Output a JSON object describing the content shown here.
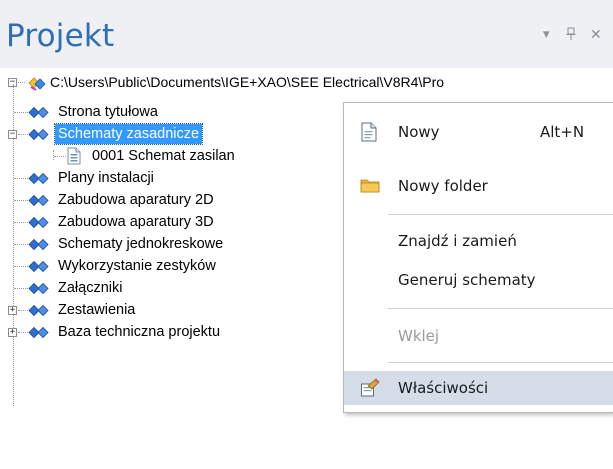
{
  "panel": {
    "title": "Projekt",
    "dropdown_glyph": "▾",
    "pin_glyph": "ᚂ",
    "close_glyph": "✕"
  },
  "tree": {
    "root_path": "C:\\Users\\Public\\Documents\\IGE+XAO\\SEE Electrical\\V8R4\\Pro",
    "items": [
      {
        "label": "Strona tytułowa"
      },
      {
        "label": "Schematy zasadnicze"
      },
      {
        "label": "0001 Schemat zasilan"
      },
      {
        "label": "Plany instalacji"
      },
      {
        "label": "Zabudowa aparatury 2D"
      },
      {
        "label": "Zabudowa aparatury 3D"
      },
      {
        "label": "Schematy jednokreskowe"
      },
      {
        "label": "Wykorzystanie zestyków"
      },
      {
        "label": "Załączniki"
      },
      {
        "label": "Zestawienia"
      },
      {
        "label": "Baza techniczna projektu"
      }
    ],
    "expanders": {
      "root": "−",
      "collapsed": "+"
    }
  },
  "context_menu": {
    "items": [
      {
        "label": "Nowy",
        "shortcut": "Alt+N",
        "icon": "new-document-icon"
      },
      {
        "label": "Nowy folder",
        "icon": "folder-icon"
      },
      {
        "label": "Znajdź i zamień"
      },
      {
        "label": "Generuj schematy"
      },
      {
        "label": "Wklej",
        "disabled": true
      },
      {
        "label": "Właściwości",
        "icon": "properties-icon"
      }
    ]
  },
  "colors": {
    "title": "#2e6fb5",
    "selection": "#3399ff",
    "menu_hover": "#d5dde8",
    "disabled_text": "#9a9a9a"
  }
}
